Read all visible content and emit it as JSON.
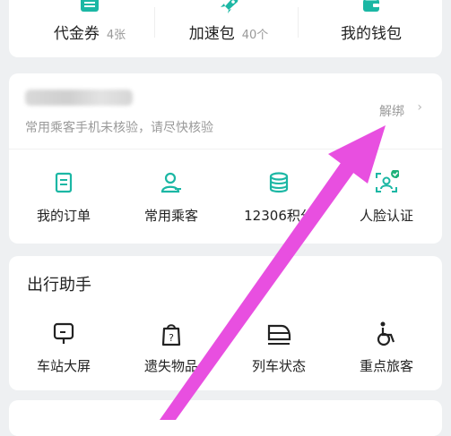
{
  "assets": [
    {
      "label": "代金券",
      "count": "4张",
      "icon": "coupon-icon"
    },
    {
      "label": "加速包",
      "count": "40个",
      "icon": "rocket-icon"
    },
    {
      "label": "我的钱包",
      "count": "",
      "icon": "wallet-icon"
    }
  ],
  "user": {
    "warning": "常用乘客手机未核验，请尽快核验",
    "unbind_label": "解绑",
    "chevron": "›"
  },
  "functions": [
    {
      "label": "我的订单",
      "icon": "order-icon"
    },
    {
      "label": "常用乘客",
      "icon": "passenger-icon"
    },
    {
      "label": "12306积分",
      "icon": "points-icon"
    },
    {
      "label": "人脸认证",
      "icon": "face-verify-icon"
    }
  ],
  "travel": {
    "title": "出行助手",
    "tools": [
      {
        "label": "车站大屏",
        "icon": "station-screen-icon"
      },
      {
        "label": "遗失物品",
        "icon": "lost-item-icon"
      },
      {
        "label": "列车状态",
        "icon": "train-status-icon"
      },
      {
        "label": "重点旅客",
        "icon": "wheelchair-icon"
      }
    ]
  },
  "colors": {
    "accent": "#1bb7a4",
    "annotation": "#e84fe0",
    "background": "#eef0f2"
  }
}
